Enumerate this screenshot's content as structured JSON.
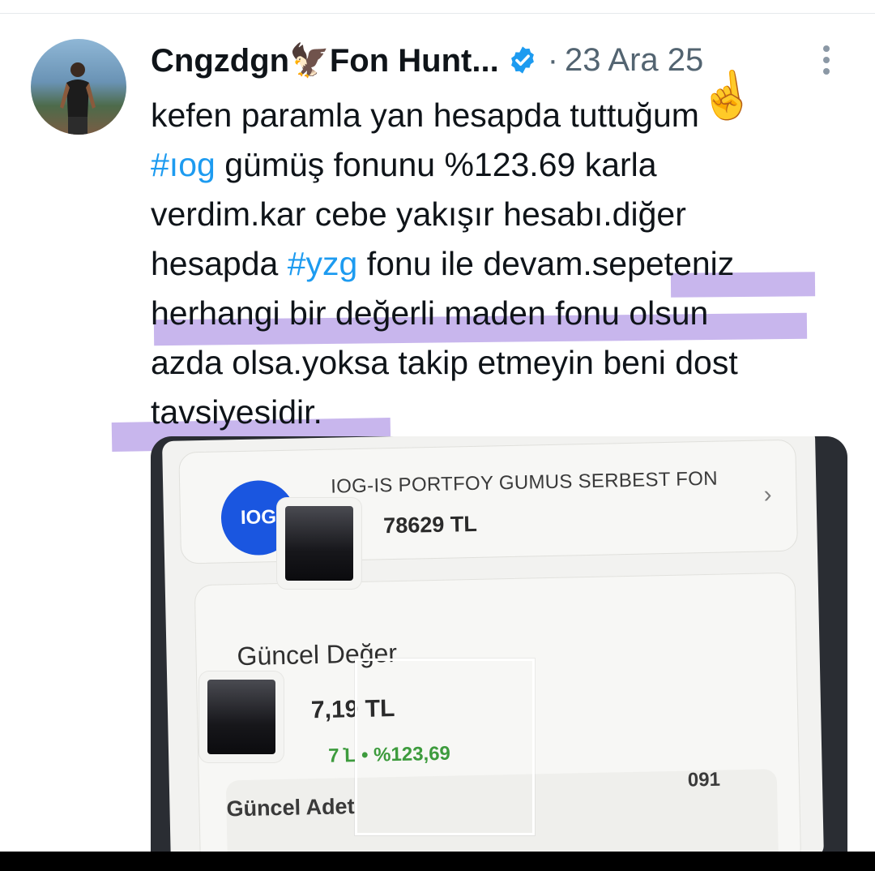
{
  "tweet": {
    "author": "Cngzdgn🦅Fon Hunt...",
    "separator": "·",
    "date": "23 Ara 25",
    "lines": [
      {
        "parts": [
          "kefen paramla yan hesapda tuttuğum"
        ]
      },
      {
        "hashtag": "#ıog",
        "rest": " gümüş fonunu %123.69 karla"
      },
      {
        "parts": [
          "verdim.kar cebe yakışır hesabı.diğer"
        ]
      },
      {
        "pre": "hesapda ",
        "hashtag": "#yzg",
        "rest": " fonu ile devam.sepeteniz"
      },
      {
        "parts": [
          "herhangi bir değerli maden fonu olsun"
        ]
      },
      {
        "parts": [
          "azda olsa.yoksa takip etmeyin beni dost"
        ]
      },
      {
        "parts": [
          "tavsiyesidir."
        ]
      }
    ],
    "emoji": "☝️"
  },
  "photo": {
    "fund_logo": "IOG",
    "fund_name": "IOG-IS PORTFOY GUMUS SERBEST FON",
    "fund_value_visible": "78629 TL",
    "current_value_label": "Güncel Değer",
    "current_value_visible": "7,19 TL",
    "change_visible": "7 ̇L • %123,69",
    "quantity_label": "Güncel Adet",
    "quantity_value_visible": "091"
  },
  "colors": {
    "hashtag": "#1d9bf0",
    "highlight": "#9a7ade",
    "gain": "#3d9b3d",
    "fund_logo_bg": "#1a56e0"
  },
  "icons": [
    "verified-badge-icon",
    "more-options-icon",
    "chevron-right-icon",
    "pointing-up-emoji"
  ]
}
